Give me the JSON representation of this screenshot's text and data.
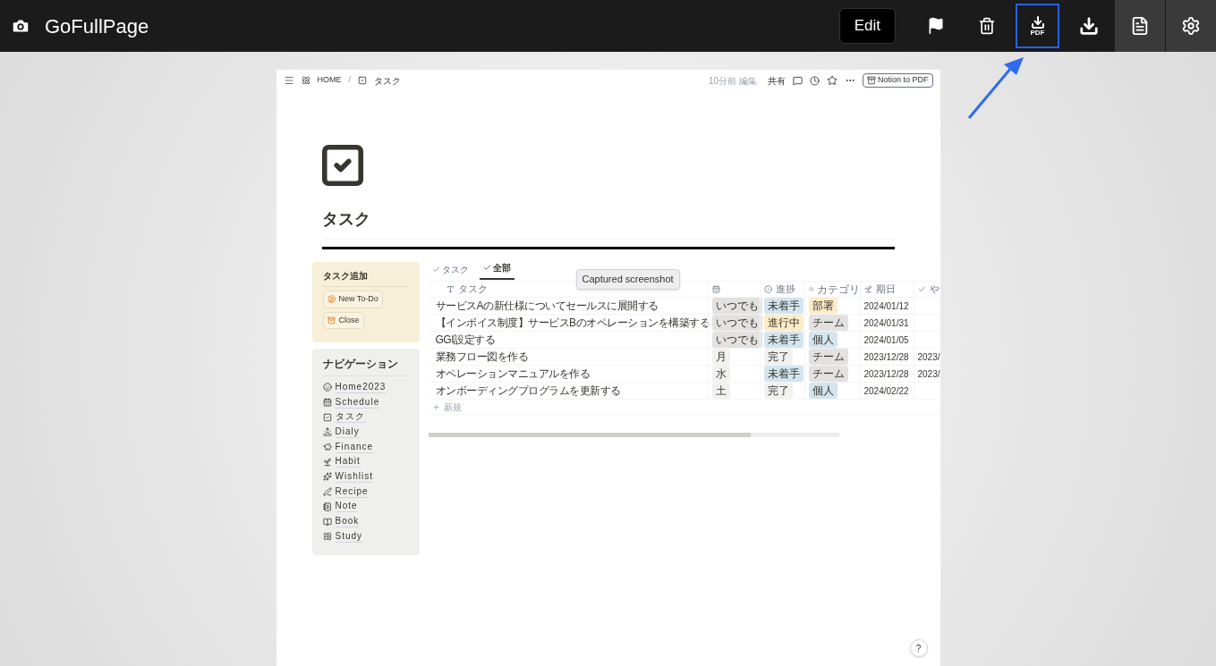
{
  "app": {
    "title": "GoFullPage"
  },
  "toolbar": [
    {
      "kind": "edit",
      "label": "Edit",
      "selected": false
    },
    {
      "kind": "flag",
      "selected": false,
      "active": false
    },
    {
      "kind": "trash",
      "selected": false,
      "active": false
    },
    {
      "kind": "pdf",
      "label": "PDF",
      "selected": true,
      "active": false
    },
    {
      "kind": "download",
      "selected": false,
      "active": false
    },
    {
      "kind": "notes",
      "selected": false,
      "active": true
    },
    {
      "kind": "settings",
      "selected": false,
      "active": true
    }
  ],
  "page": {
    "breadcrumb": [
      "HOME",
      "/",
      "タスク"
    ],
    "edited": "10分前 編集",
    "share": "共有",
    "export_button": "Notion to PDF",
    "title": "タスク",
    "add_panel": {
      "heading": "タスク追加",
      "buttons": [
        "New To-Do",
        "Close"
      ]
    },
    "nav_panel": {
      "heading": "ナビゲーション",
      "items": [
        "Home2023",
        "Schedule",
        "タスク",
        "Dialy",
        "Finance",
        "Habit",
        "Wishlist",
        "Recipe",
        "Note",
        "Book",
        "Study"
      ]
    },
    "views": [
      {
        "label": "タスク",
        "selected": false
      },
      {
        "label": "全部",
        "selected": true
      }
    ],
    "table": {
      "columns": [
        "タスク",
        "",
        "進捗",
        "カテゴリ",
        "期日",
        "や"
      ],
      "rows": [
        {
          "task": "サービスAの新仕様についてセールスに展開する",
          "day": {
            "text": "いつでも",
            "color": "#e3e2e0"
          },
          "status": {
            "text": "未着手",
            "color": "#d3e5ef"
          },
          "category": {
            "text": "部署",
            "color": "#fdecc8"
          },
          "due": "2024/01/12",
          "column_6": ""
        },
        {
          "task": "【インボイス制度】サービスBのオペレーションを構築する",
          "day": {
            "text": "いつでも",
            "color": "#e3e2e0"
          },
          "status": {
            "text": "進行中",
            "color": "#fdecc8"
          },
          "category": {
            "text": "チーム",
            "color": "#e3e2e0"
          },
          "due": "2024/01/31",
          "column_6": ""
        },
        {
          "task": "GGI設定する",
          "day": {
            "text": "いつでも",
            "color": "#e3e2e0"
          },
          "status": {
            "text": "未着手",
            "color": "#d3e5ef"
          },
          "category": {
            "text": "個人",
            "color": "#d3e5ef"
          },
          "due": "2024/01/05",
          "column_6": ""
        },
        {
          "task": "業務フロー図を作る",
          "day": {
            "text": "月",
            "color": "#f1f1ef"
          },
          "status": {
            "text": "完了",
            "color": "#f1f1ef"
          },
          "category": {
            "text": "チーム",
            "color": "#e3e2e0"
          },
          "due": "2023/12/28",
          "column_6": "2023/"
        },
        {
          "task": "オペレーションマニュアルを作る",
          "day": {
            "text": "水",
            "color": "#f1f1ef"
          },
          "status": {
            "text": "未着手",
            "color": "#d3e5ef"
          },
          "category": {
            "text": "チーム",
            "color": "#e3e2e0"
          },
          "due": "2023/12/28",
          "column_6": "2023/"
        },
        {
          "task": "オンボーディングプログラムを更新する",
          "day": {
            "text": "土",
            "color": "#f1f1ef"
          },
          "status": {
            "text": "完了",
            "color": "#f1f1ef"
          },
          "category": {
            "text": "個人",
            "color": "#d3e5ef"
          },
          "due": "2024/02/22",
          "column_6": ""
        }
      ],
      "new_row": "新規"
    },
    "tooltip": "Captured screenshot",
    "help": "?"
  }
}
